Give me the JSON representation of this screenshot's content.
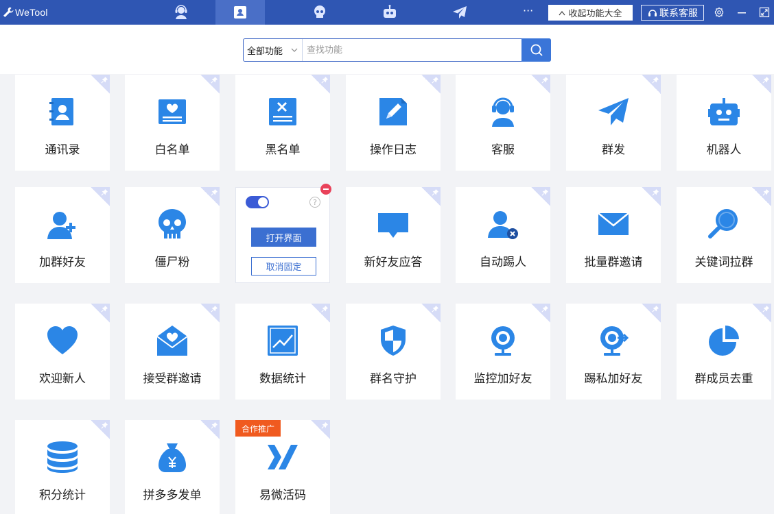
{
  "app": {
    "name": "WeTool"
  },
  "colors": {
    "titlebar": "#2f56b3",
    "accent": "#3a75d8",
    "icon_blue": "#2b86e6",
    "card_corner": "#d6dcf7",
    "promo": "#f05a1f"
  },
  "nav_tabs": [
    {
      "icon": "customer-service-icon",
      "active": false
    },
    {
      "icon": "contacts-icon",
      "active": true
    },
    {
      "icon": "skull-icon",
      "active": false
    },
    {
      "icon": "robot-icon",
      "active": false
    },
    {
      "icon": "send-icon",
      "active": false
    }
  ],
  "header": {
    "more": "···",
    "collapse_label": "收起功能大全",
    "contact_label": "联系客服"
  },
  "search": {
    "category": "全部功能",
    "placeholder": "查找功能",
    "value": ""
  },
  "cards": [
    {
      "label": "通讯录",
      "icon": "contacts-book-icon"
    },
    {
      "label": "白名单",
      "icon": "whitelist-icon"
    },
    {
      "label": "黑名单",
      "icon": "blacklist-icon"
    },
    {
      "label": "操作日志",
      "icon": "log-icon"
    },
    {
      "label": "客服",
      "icon": "customer-service-icon"
    },
    {
      "label": "群发",
      "icon": "send-icon"
    },
    {
      "label": "机器人",
      "icon": "robot-icon"
    },
    {
      "label": "加群好友",
      "icon": "add-user-icon"
    },
    {
      "label": "僵尸粉",
      "icon": "skull-icon"
    },
    {
      "label": "",
      "icon": "",
      "expanded": true,
      "open_label": "打开界面",
      "unpin_label": "取消固定",
      "qmark": "?"
    },
    {
      "label": "新好友应答",
      "icon": "message-icon"
    },
    {
      "label": "自动踢人",
      "icon": "remove-user-icon"
    },
    {
      "label": "批量群邀请",
      "icon": "envelope-icon"
    },
    {
      "label": "关键词拉群",
      "icon": "magnifier-icon"
    },
    {
      "label": "欢迎新人",
      "icon": "heart-icon"
    },
    {
      "label": "接受群邀请",
      "icon": "heart-envelope-icon"
    },
    {
      "label": "数据统计",
      "icon": "chart-icon"
    },
    {
      "label": "群名守护",
      "icon": "shield-icon"
    },
    {
      "label": "监控加好友",
      "icon": "webcam-icon"
    },
    {
      "label": "踢私加好友",
      "icon": "webcam-arrow-icon"
    },
    {
      "label": "群成员去重",
      "icon": "pie-icon"
    },
    {
      "label": "积分统计",
      "icon": "database-icon"
    },
    {
      "label": "拼多多发单",
      "icon": "money-bag-icon"
    },
    {
      "label": "易微活码",
      "icon": "xw-logo-icon",
      "promo": "合作推广"
    }
  ]
}
